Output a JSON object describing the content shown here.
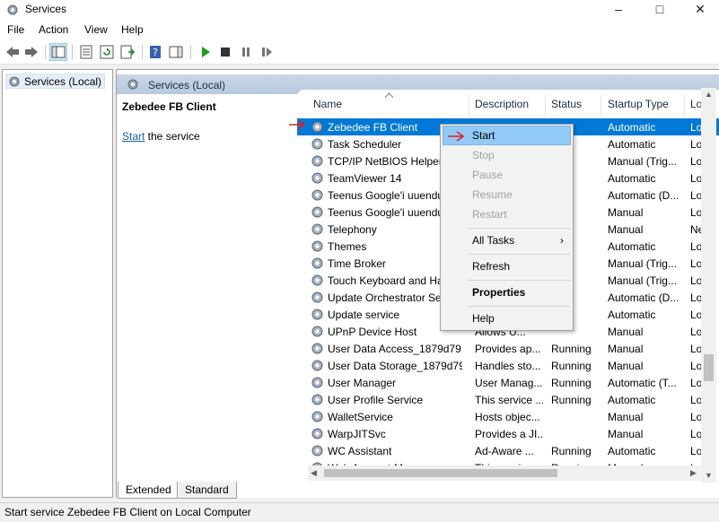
{
  "window": {
    "title": "Services"
  },
  "menu": [
    "File",
    "Action",
    "View",
    "Help"
  ],
  "tree": {
    "node_label": "Services (Local)"
  },
  "pane_header": "Services (Local)",
  "details": {
    "service_name": "Zebedee FB Client",
    "link_text": "Start",
    "link_suffix": " the service"
  },
  "columns": [
    "Name",
    "Description",
    "Status",
    "Startup Type",
    "Lo"
  ],
  "rows": [
    {
      "name": "Zebedee FB Client",
      "description": "",
      "status": "",
      "startup": "Automatic",
      "logon": "Lo"
    },
    {
      "name": "Task Scheduler",
      "description": "",
      "status": "ning",
      "startup": "Automatic",
      "logon": "Lo"
    },
    {
      "name": "TCP/IP NetBIOS Helper",
      "description": "",
      "status": "ning",
      "startup": "Manual (Trig...",
      "logon": "Lo"
    },
    {
      "name": "TeamViewer 14",
      "description": "",
      "status": "ning",
      "startup": "Automatic",
      "logon": "Lo"
    },
    {
      "name": "Teenus Google'i uuendu",
      "description": "",
      "status": "",
      "startup": "Automatic (D...",
      "logon": "Lo"
    },
    {
      "name": "Teenus Google'i uuendu",
      "description": "",
      "status": "",
      "startup": "Manual",
      "logon": "Lo"
    },
    {
      "name": "Telephony",
      "description": "",
      "status": "",
      "startup": "Manual",
      "logon": "Ne"
    },
    {
      "name": "Themes",
      "description": "",
      "status": "ning",
      "startup": "Automatic",
      "logon": "Lo"
    },
    {
      "name": "Time Broker",
      "description": "",
      "status": "ning",
      "startup": "Manual (Trig...",
      "logon": "Lo"
    },
    {
      "name": "Touch Keyboard and Ha",
      "description": "",
      "status": "ning",
      "startup": "Manual (Trig...",
      "logon": "Lo"
    },
    {
      "name": "Update Orchestrator Ser",
      "description": "",
      "status": "ning",
      "startup": "Automatic (D...",
      "logon": "Lo"
    },
    {
      "name": "Update service",
      "description": "",
      "status": "ning",
      "startup": "Automatic",
      "logon": "Lo"
    },
    {
      "name": "UPnP Device Host",
      "description": "Allows U...",
      "status": "",
      "startup": "Manual",
      "logon": "Lo"
    },
    {
      "name": "User Data Access_1879d79",
      "description": "Provides ap...",
      "status": "Running",
      "startup": "Manual",
      "logon": "Lo"
    },
    {
      "name": "User Data Storage_1879d79",
      "description": "Handles sto...",
      "status": "Running",
      "startup": "Manual",
      "logon": "Lo"
    },
    {
      "name": "User Manager",
      "description": "User Manag...",
      "status": "Running",
      "startup": "Automatic (T...",
      "logon": "Lo"
    },
    {
      "name": "User Profile Service",
      "description": "This service ...",
      "status": "Running",
      "startup": "Automatic",
      "logon": "Lo"
    },
    {
      "name": "WalletService",
      "description": "Hosts objec...",
      "status": "",
      "startup": "Manual",
      "logon": "Lo"
    },
    {
      "name": "WarpJITSvc",
      "description": "Provides a JI...",
      "status": "",
      "startup": "Manual",
      "logon": "Lo"
    },
    {
      "name": "WC Assistant",
      "description": "Ad-Aware ...",
      "status": "Running",
      "startup": "Automatic",
      "logon": "Lo"
    },
    {
      "name": "Web Account Manager",
      "description": "This service ...",
      "status": "Running",
      "startup": "Manual",
      "logon": "Lo"
    }
  ],
  "context_menu": {
    "start": "Start",
    "stop": "Stop",
    "pause": "Pause",
    "resume": "Resume",
    "restart": "Restart",
    "all_tasks": "All Tasks",
    "refresh": "Refresh",
    "properties": "Properties",
    "help": "Help"
  },
  "tabs": [
    "Extended",
    "Standard"
  ],
  "status_bar": "Start service Zebedee FB Client on Local Computer",
  "colors": {
    "selection": "#0078d7",
    "menu_highlight": "#91c9f7",
    "annotation_arrow": "#e02020"
  }
}
